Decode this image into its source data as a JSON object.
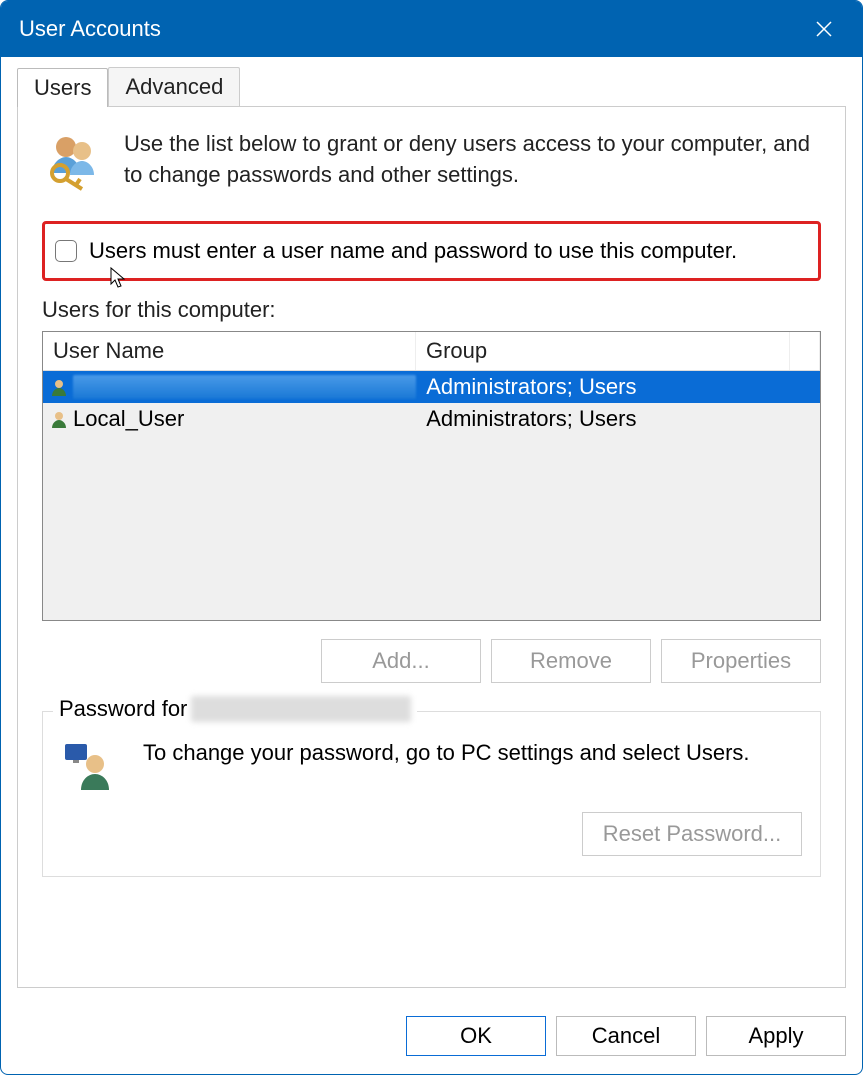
{
  "window": {
    "title": "User Accounts"
  },
  "tabs": {
    "users": "Users",
    "advanced": "Advanced"
  },
  "intro": "Use the list below to grant or deny users access to your computer, and to change passwords and other settings.",
  "checkbox_label": "Users must enter a user name and password to use this computer.",
  "users_section_label": "Users for this computer:",
  "table": {
    "headers": {
      "name": "User Name",
      "group": "Group"
    },
    "rows": [
      {
        "name": "",
        "group": "Administrators; Users",
        "selected": true
      },
      {
        "name": "Local_User",
        "group": "Administrators; Users",
        "selected": false
      }
    ]
  },
  "buttons": {
    "add": "Add...",
    "remove": "Remove",
    "properties": "Properties"
  },
  "password_box": {
    "legend_prefix": "Password for",
    "text": "To change your password, go to PC settings and select Users.",
    "reset": "Reset Password..."
  },
  "footer": {
    "ok": "OK",
    "cancel": "Cancel",
    "apply": "Apply"
  }
}
